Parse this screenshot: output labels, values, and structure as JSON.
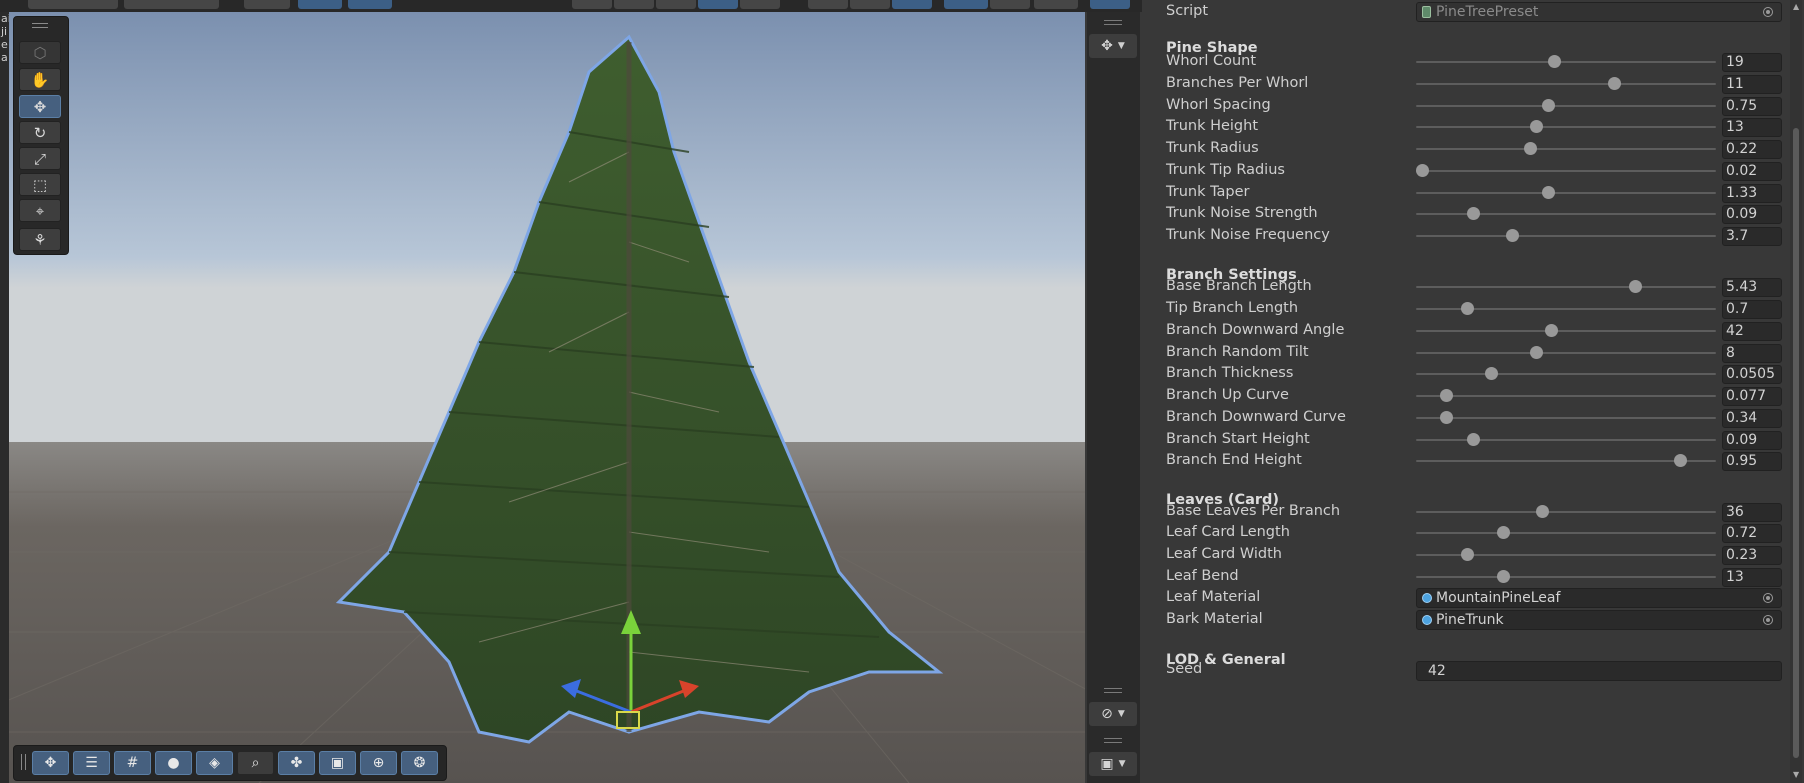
{
  "scene": {
    "left_hint_chars": [
      "ai",
      "ji",
      "e",
      "a"
    ],
    "tools": [
      {
        "name": "view-tool",
        "icon": "cube-icon",
        "glyph": "⬡"
      },
      {
        "name": "hand-tool",
        "icon": "hand-icon",
        "glyph": "✋"
      },
      {
        "name": "move-tool",
        "icon": "move-arrows-icon",
        "glyph": "✥"
      },
      {
        "name": "rotate-tool",
        "icon": "rotate-icon",
        "glyph": "↻"
      },
      {
        "name": "scale-tool",
        "icon": "scale-icon",
        "glyph": "⤢"
      },
      {
        "name": "rect-tool",
        "icon": "rect-transform-icon",
        "glyph": "⬚"
      },
      {
        "name": "transform-tool",
        "icon": "transform-icon",
        "glyph": "⌖"
      },
      {
        "name": "custom-tool",
        "icon": "custom-tool-icon",
        "glyph": "⚘"
      }
    ],
    "bottom_toolbar": [
      {
        "name": "move-overlay",
        "icon": "move-arrows-icon",
        "glyph": "✥"
      },
      {
        "name": "snap-settings",
        "icon": "sliders-icon",
        "glyph": "☰"
      },
      {
        "name": "grid-toggle",
        "icon": "grid-icon",
        "glyph": "#"
      },
      {
        "name": "shading-mode",
        "icon": "sphere-icon",
        "glyph": "●"
      },
      {
        "name": "layers",
        "icon": "layers-icon",
        "glyph": "◈"
      },
      {
        "name": "search",
        "icon": "search-icon",
        "glyph": "⌕"
      },
      {
        "name": "pivot",
        "icon": "pivot-icon",
        "glyph": "✤"
      },
      {
        "name": "camera",
        "icon": "camera-icon",
        "glyph": "▣"
      },
      {
        "name": "gizmos",
        "icon": "compass-icon",
        "glyph": "⊕"
      },
      {
        "name": "effects",
        "icon": "effects-icon",
        "glyph": "❂"
      }
    ]
  },
  "inspector": {
    "script": {
      "label": "Script",
      "value": "PineTreePreset"
    },
    "sections": [
      {
        "title": "Pine Shape",
        "rows": [
          {
            "label": "Whorl Count",
            "value": "19",
            "pos": 0.46
          },
          {
            "label": "Branches Per Whorl",
            "value": "11",
            "pos": 0.66
          },
          {
            "label": "Whorl Spacing",
            "value": "0.75",
            "pos": 0.44
          },
          {
            "label": "Trunk Height",
            "value": "13",
            "pos": 0.4
          },
          {
            "label": "Trunk Radius",
            "value": "0.22",
            "pos": 0.38
          },
          {
            "label": "Trunk Tip Radius",
            "value": "0.02",
            "pos": 0.02
          },
          {
            "label": "Trunk Taper",
            "value": "1.33",
            "pos": 0.44
          },
          {
            "label": "Trunk Noise Strength",
            "value": "0.09",
            "pos": 0.19
          },
          {
            "label": "Trunk Noise Frequency",
            "value": "3.7",
            "pos": 0.32
          }
        ]
      },
      {
        "title": "Branch Settings",
        "rows": [
          {
            "label": "Base Branch Length",
            "value": "5.43",
            "pos": 0.73
          },
          {
            "label": "Tip Branch Length",
            "value": "0.7",
            "pos": 0.17
          },
          {
            "label": "Branch Downward Angle",
            "value": "42",
            "pos": 0.45
          },
          {
            "label": "Branch Random Tilt",
            "value": "8",
            "pos": 0.4
          },
          {
            "label": "Branch Thickness",
            "value": "0.0505",
            "pos": 0.25
          },
          {
            "label": "Branch Up Curve",
            "value": "0.077",
            "pos": 0.1
          },
          {
            "label": "Branch Downward Curve",
            "value": "0.34",
            "pos": 0.1
          },
          {
            "label": "Branch Start Height",
            "value": "0.09",
            "pos": 0.19
          },
          {
            "label": "Branch End Height",
            "value": "0.95",
            "pos": 0.88
          }
        ]
      },
      {
        "title": "Leaves (Card)",
        "rows": [
          {
            "label": "Base Leaves Per Branch",
            "value": "36",
            "pos": 0.42
          },
          {
            "label": "Leaf Card Length",
            "value": "0.72",
            "pos": 0.29
          },
          {
            "label": "Leaf Card Width",
            "value": "0.23",
            "pos": 0.17
          },
          {
            "label": "Leaf Bend",
            "value": "13",
            "pos": 0.29
          }
        ],
        "objects": [
          {
            "label": "Leaf Material",
            "value": "MountainPineLeaf"
          },
          {
            "label": "Bark Material",
            "value": "PineTrunk"
          }
        ]
      },
      {
        "title": "LOD & General",
        "rows": [],
        "fields": [
          {
            "label": "Seed",
            "value": "42"
          }
        ]
      }
    ]
  },
  "colors": {
    "panel_bg": "#383838",
    "field_bg": "#2a2a2a",
    "active_tool": "#46607f",
    "sky_top": "#7d93b2",
    "ground": "#5e5a55",
    "foliage": "#35502a",
    "selection_outline": "#7ea6e6"
  }
}
